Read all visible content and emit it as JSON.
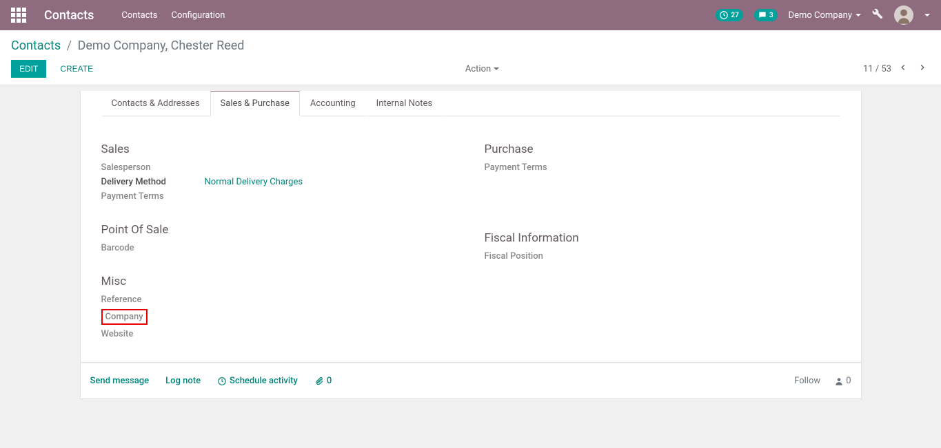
{
  "navbar": {
    "brand": "Contacts",
    "menu": [
      "Contacts",
      "Configuration"
    ],
    "activity_count": "27",
    "discuss_count": "3",
    "company": "Demo Company"
  },
  "breadcrumb": {
    "root": "Contacts",
    "current": "Demo Company, Chester Reed"
  },
  "buttons": {
    "edit": "EDIT",
    "create": "CREATE",
    "action": "Action"
  },
  "pager": {
    "pos": "11 / 53"
  },
  "tabs": [
    "Contacts & Addresses",
    "Sales & Purchase",
    "Accounting",
    "Internal Notes"
  ],
  "active_tab": 1,
  "sections": {
    "sales": {
      "title": "Sales",
      "salesperson_label": "Salesperson",
      "delivery_method_label": "Delivery Method",
      "delivery_method_value": "Normal Delivery Charges",
      "payment_terms_label": "Payment Terms"
    },
    "pos": {
      "title": "Point Of Sale",
      "barcode_label": "Barcode"
    },
    "misc": {
      "title": "Misc",
      "reference_label": "Reference",
      "company_label": "Company",
      "website_label": "Website"
    },
    "purchase": {
      "title": "Purchase",
      "payment_terms_label": "Payment Terms"
    },
    "fiscal": {
      "title": "Fiscal Information",
      "fiscal_position_label": "Fiscal Position"
    }
  },
  "chatter": {
    "send_message": "Send message",
    "log_note": "Log note",
    "schedule_activity": "Schedule activity",
    "attachments": "0",
    "follow": "Follow",
    "followers": "0"
  }
}
